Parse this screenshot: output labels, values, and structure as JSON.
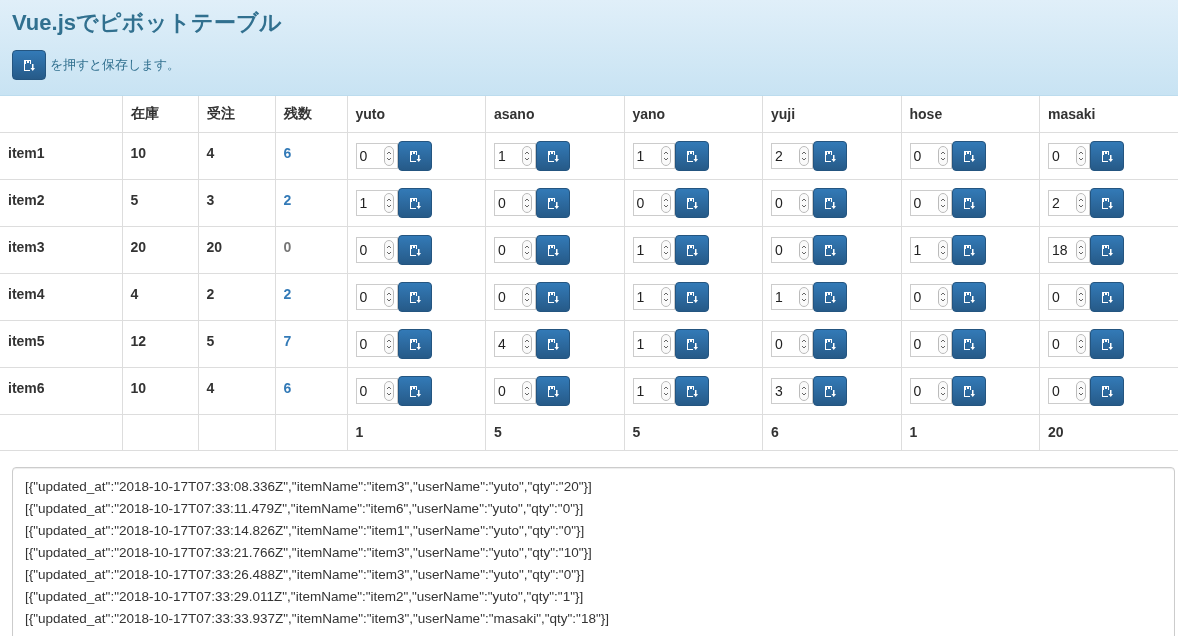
{
  "header": {
    "title": "Vue.jsでピボットテーブル",
    "hint_text": "を押すと保存します。"
  },
  "table": {
    "columns": [
      "在庫",
      "受注",
      "残数",
      "yuto",
      "asano",
      "yano",
      "yuji",
      "hose",
      "masaki"
    ],
    "rows": [
      {
        "item": "item1",
        "stock": "10",
        "orders": "4",
        "remaining": {
          "value": "6",
          "highlighted": true
        },
        "quantities": [
          "0",
          "1",
          "1",
          "2",
          "0",
          "0"
        ]
      },
      {
        "item": "item2",
        "stock": "5",
        "orders": "3",
        "remaining": {
          "value": "2",
          "highlighted": true
        },
        "quantities": [
          "1",
          "0",
          "0",
          "0",
          "0",
          "2"
        ]
      },
      {
        "item": "item3",
        "stock": "20",
        "orders": "20",
        "remaining": {
          "value": "0",
          "highlighted": false
        },
        "quantities": [
          "0",
          "0",
          "1",
          "0",
          "1",
          "18"
        ]
      },
      {
        "item": "item4",
        "stock": "4",
        "orders": "2",
        "remaining": {
          "value": "2",
          "highlighted": true
        },
        "quantities": [
          "0",
          "0",
          "1",
          "1",
          "0",
          "0"
        ]
      },
      {
        "item": "item5",
        "stock": "12",
        "orders": "5",
        "remaining": {
          "value": "7",
          "highlighted": true
        },
        "quantities": [
          "0",
          "4",
          "1",
          "0",
          "0",
          "0"
        ]
      },
      {
        "item": "item6",
        "stock": "10",
        "orders": "4",
        "remaining": {
          "value": "6",
          "highlighted": true
        },
        "quantities": [
          "0",
          "0",
          "1",
          "3",
          "0",
          "0"
        ]
      }
    ],
    "totals": [
      "1",
      "5",
      "5",
      "6",
      "1",
      "20"
    ]
  },
  "log": [
    "[{\"updated_at\":\"2018-10-17T07:33:08.336Z\",\"itemName\":\"item3\",\"userName\":\"yuto\",\"qty\":\"20\"}]",
    "[{\"updated_at\":\"2018-10-17T07:33:11.479Z\",\"itemName\":\"item6\",\"userName\":\"yuto\",\"qty\":\"0\"}]",
    "[{\"updated_at\":\"2018-10-17T07:33:14.826Z\",\"itemName\":\"item1\",\"userName\":\"yuto\",\"qty\":\"0\"}]",
    "[{\"updated_at\":\"2018-10-17T07:33:21.766Z\",\"itemName\":\"item3\",\"userName\":\"yuto\",\"qty\":\"10\"}]",
    "[{\"updated_at\":\"2018-10-17T07:33:26.488Z\",\"itemName\":\"item3\",\"userName\":\"yuto\",\"qty\":\"0\"}]",
    "[{\"updated_at\":\"2018-10-17T07:33:29.011Z\",\"itemName\":\"item2\",\"userName\":\"yuto\",\"qty\":\"1\"}]",
    "[{\"updated_at\":\"2018-10-17T07:33:33.937Z\",\"itemName\":\"item3\",\"userName\":\"masaki\",\"qty\":\"18\"}]"
  ]
}
